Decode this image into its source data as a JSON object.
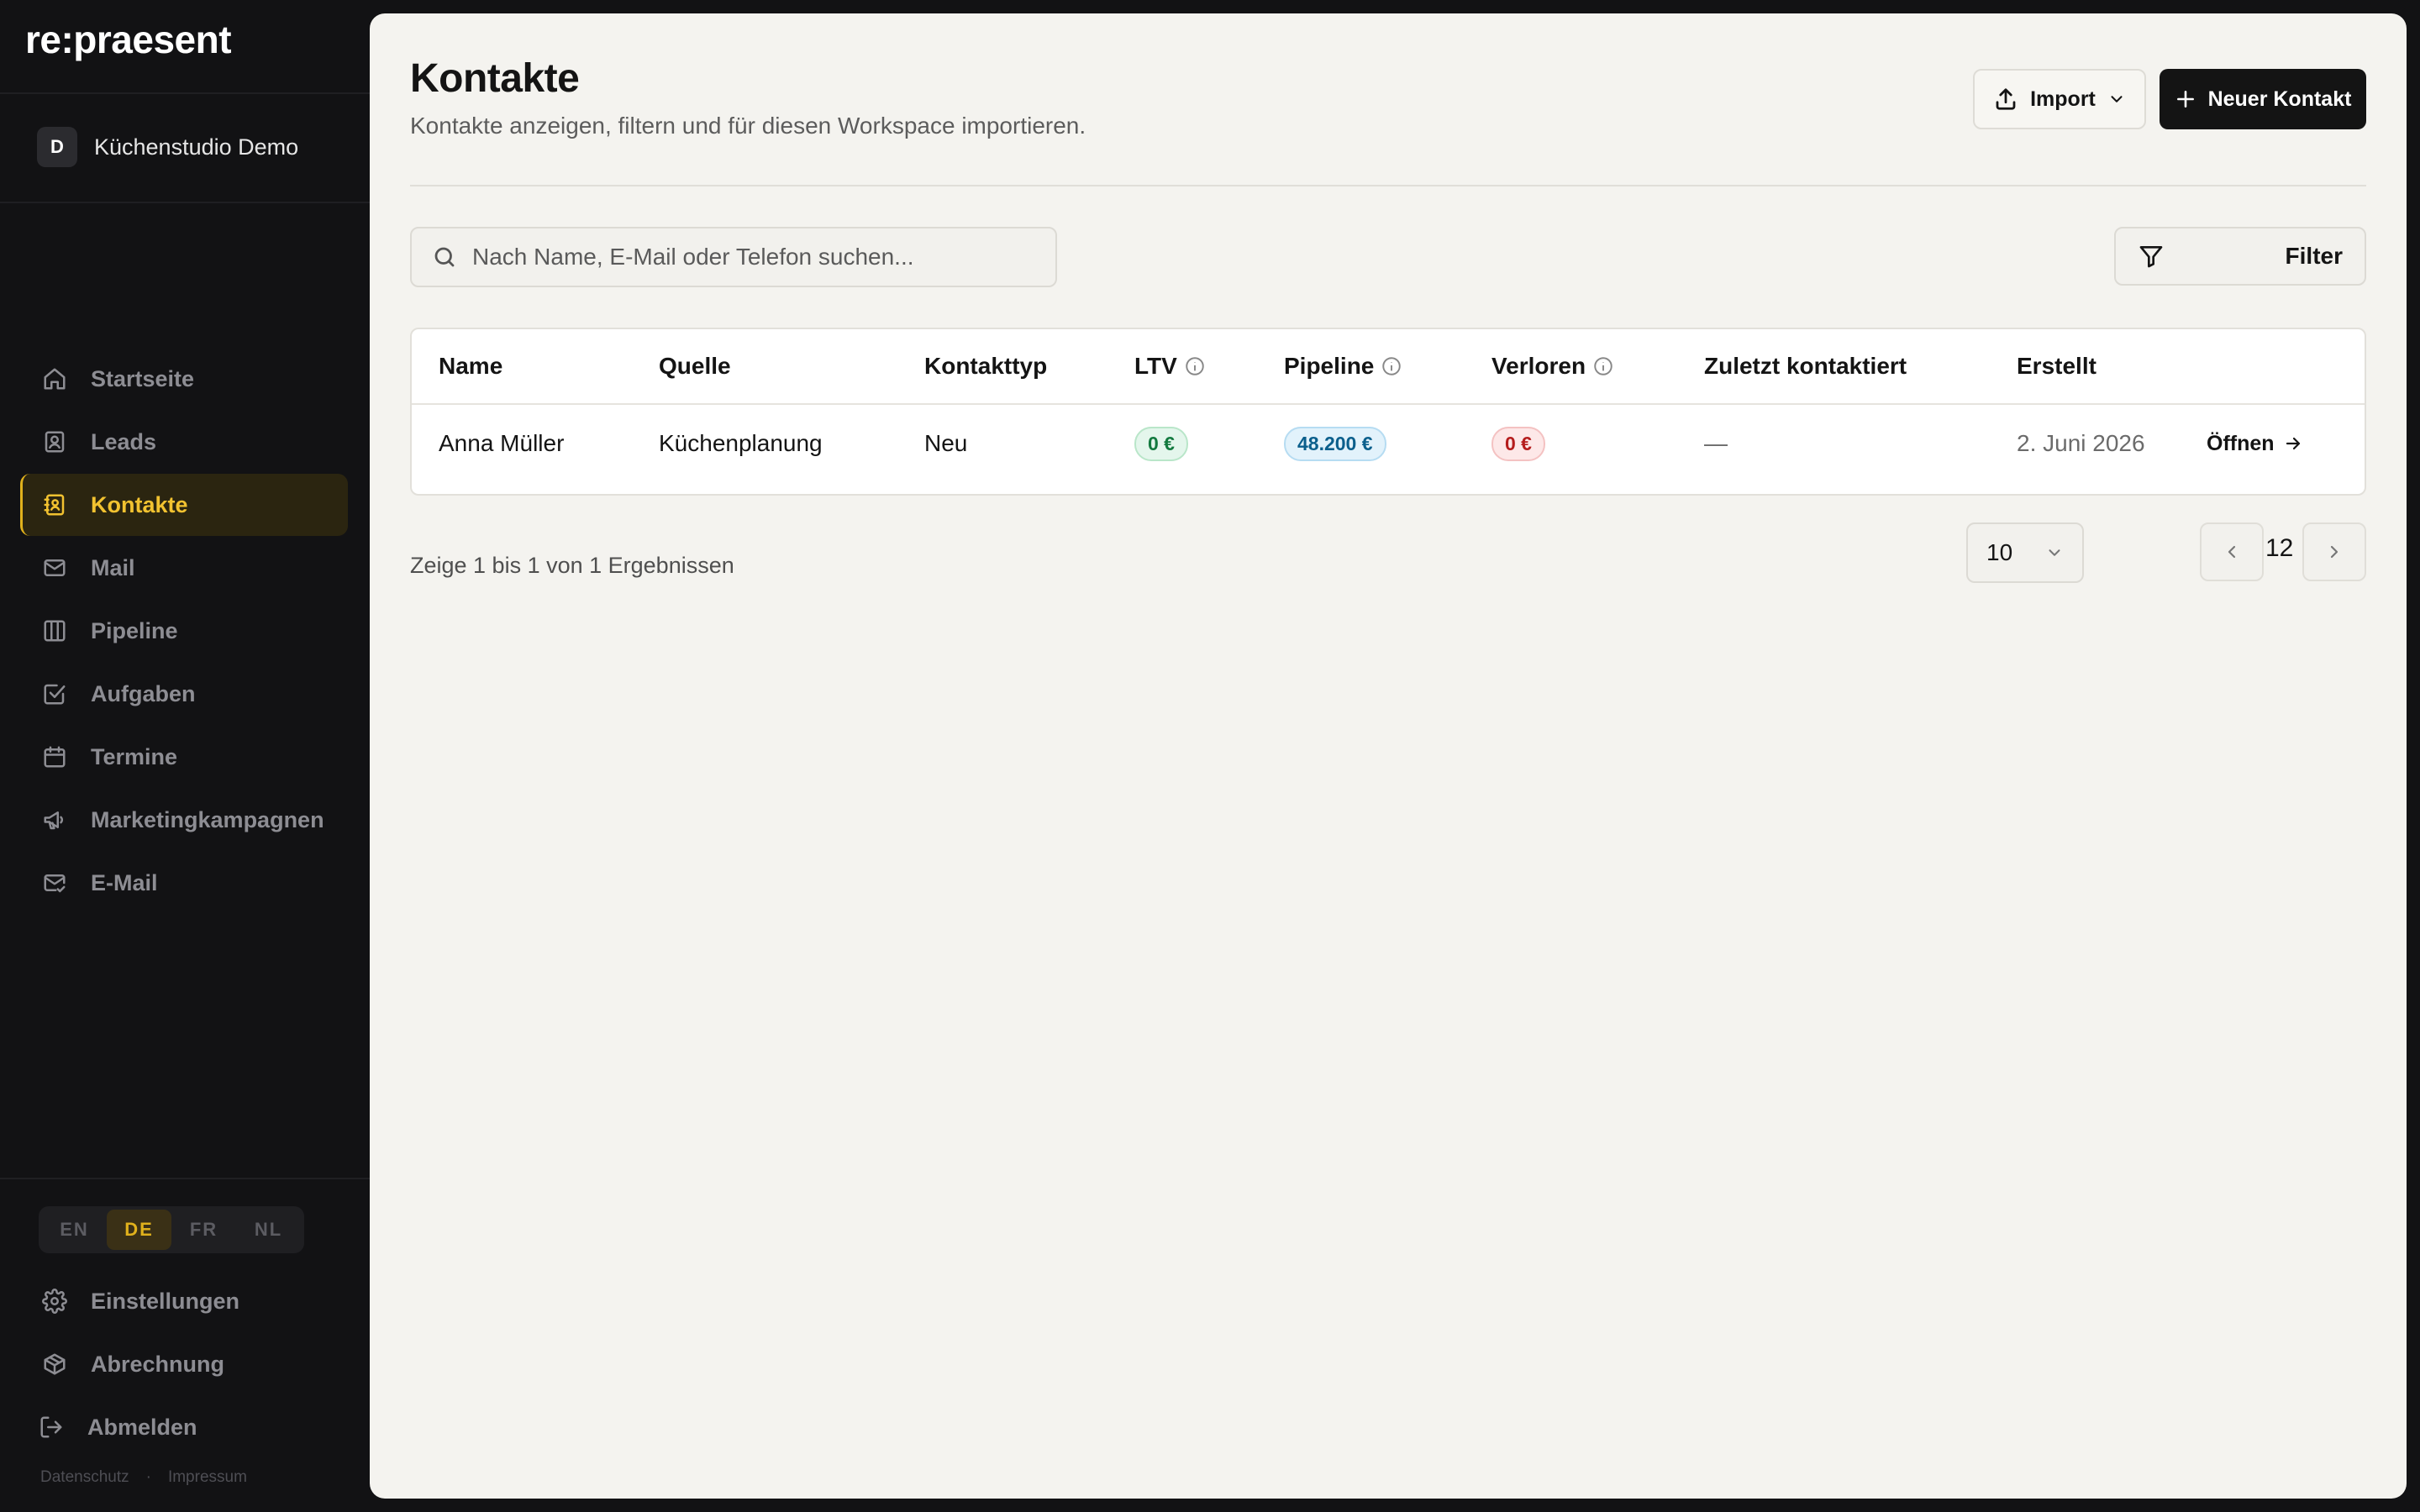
{
  "app": {
    "logo": "re:praesent"
  },
  "workspace": {
    "avatar_letter": "D",
    "name": "Küchenstudio Demo"
  },
  "sidebar": {
    "items": [
      {
        "label": "Startseite",
        "icon": "home-icon"
      },
      {
        "label": "Leads",
        "icon": "contact-card-icon"
      },
      {
        "label": "Kontakte",
        "icon": "contact-book-icon",
        "active": true
      },
      {
        "label": "Mail",
        "icon": "mail-icon"
      },
      {
        "label": "Pipeline",
        "icon": "columns-icon"
      },
      {
        "label": "Aufgaben",
        "icon": "check-square-icon"
      },
      {
        "label": "Termine",
        "icon": "calendar-icon"
      },
      {
        "label": "Marketingkampagnen",
        "icon": "megaphone-icon"
      },
      {
        "label": "E-Mail",
        "icon": "mail-check-icon"
      }
    ],
    "languages": [
      "EN",
      "DE",
      "FR",
      "NL"
    ],
    "active_language": "DE",
    "bottom_items": [
      {
        "label": "Einstellungen",
        "icon": "gear-icon"
      },
      {
        "label": "Abrechnung",
        "icon": "package-icon"
      },
      {
        "label": "Abmelden",
        "icon": "logout-icon"
      }
    ],
    "footer": {
      "privacy": "Datenschutz",
      "separator": "·",
      "imprint": "Impressum"
    }
  },
  "header": {
    "title": "Kontakte",
    "subtitle": "Kontakte anzeigen, filtern und für diesen Workspace importieren.",
    "import_label": "Import",
    "new_label": "Neuer Kontakt"
  },
  "search": {
    "placeholder": "Nach Name, E-Mail oder Telefon suchen...",
    "value": ""
  },
  "filter_label": "Filter",
  "table": {
    "columns": [
      "Name",
      "Quelle",
      "Kontakttyp",
      "LTV",
      "Pipeline",
      "Verloren",
      "Zuletzt kontaktiert",
      "Erstellt"
    ],
    "rows": [
      {
        "name": "Anna Müller",
        "source": "Küchenplanung",
        "type": "Neu",
        "ltv": "0 €",
        "pipeline": "48.200 €",
        "lost": "0 €",
        "last_contacted": "—",
        "created": "2. Juni 2026",
        "action": "Öffnen"
      }
    ]
  },
  "pagination": {
    "results_text": "Zeige 1 bis 1 von 1 Ergebnissen",
    "page_size": "10",
    "current_page": "12"
  },
  "colors": {
    "accent": "#e0b11c",
    "sidebar_bg": "#121214",
    "main_bg": "#f4f3ef"
  }
}
